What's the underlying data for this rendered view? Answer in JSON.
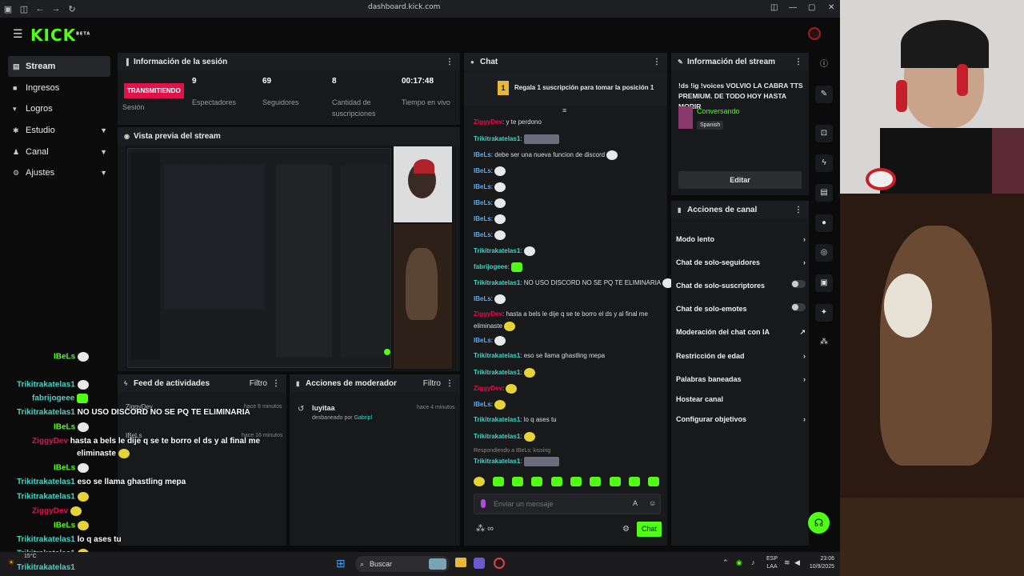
{
  "browser": {
    "url": "dashboard.kick.com"
  },
  "logo": "KICK",
  "logo_badge": "BETA",
  "sidebar": {
    "items": [
      {
        "label": "Stream"
      },
      {
        "label": "Ingresos"
      },
      {
        "label": "Logros"
      },
      {
        "label": "Estudio"
      },
      {
        "label": "Canal"
      },
      {
        "label": "Ajustes"
      }
    ]
  },
  "session": {
    "title": "Información de la sesión",
    "live_badge": "TRANSMITIENDO",
    "live_label": "Sesión",
    "stats": [
      {
        "value": "9",
        "label": "Espectadores"
      },
      {
        "value": "69",
        "label": "Seguidores"
      },
      {
        "value": "8",
        "label": "Cantidad de suscripciones"
      },
      {
        "value": "00:17:48",
        "label": "Tiempo en vivo"
      }
    ]
  },
  "preview": {
    "title": "Vista previa del stream"
  },
  "feed": {
    "title": "Feed de actividades",
    "filter": "Filtro",
    "items": [
      {
        "user": "ZiggyDev",
        "time": "hace 6 minutos"
      },
      {
        "user": "IBeLs",
        "time": "hace 16 minutos"
      }
    ]
  },
  "mod": {
    "title": "Acciones de moderador",
    "filter": "Filtro",
    "user": "luyitaa",
    "time": "hace 4 minutos",
    "action": "desbaneado por",
    "by": "Gabripl"
  },
  "chat": {
    "title": "Chat",
    "gift_text": "Regala 1 suscripción para tomar la posición 1",
    "gift_rank": "1",
    "messages": [
      {
        "user": "ZiggyDev",
        "text": ": y te perdono"
      },
      {
        "user": "Trikitrakatelas1",
        "text": ":"
      },
      {
        "user": "IBeLs",
        "text": ": debe ser una nueva funcion de discord"
      },
      {
        "user": "IBeLs",
        "text": ":"
      },
      {
        "user": "IBeLs",
        "text": ":"
      },
      {
        "user": "IBeLs",
        "text": ":"
      },
      {
        "user": "IBeLs",
        "text": ":"
      },
      {
        "user": "IBeLs",
        "text": ":"
      },
      {
        "user": "Trikitrakatelas1",
        "text": ":"
      },
      {
        "user": "fabrijogeee",
        "text": ":"
      },
      {
        "user": "Trikitrakatelas1",
        "text": ": NO USO DISCORD NO SE PQ TE ELIMINARIA"
      },
      {
        "user": "IBeLs",
        "text": ":"
      },
      {
        "user": "ZiggyDev",
        "text": ": hasta a bels le dije q se te borro el ds y al final me"
      },
      {
        "user": "",
        "text": "eliminaste"
      },
      {
        "user": "IBeLs",
        "text": ":"
      },
      {
        "user": "Trikitrakatelas1",
        "text": ": eso se llama ghastling mepa"
      },
      {
        "user": "Trikitrakatelas1",
        "text": ":"
      },
      {
        "user": "ZiggyDev",
        "text": ":"
      },
      {
        "user": "IBeLs",
        "text": ":"
      },
      {
        "user": "Trikitrakatelas1",
        "text": ": lo q ases tu"
      },
      {
        "user": "Trikitrakatelas1",
        "text": ":"
      },
      {
        "user": "",
        "text": "Respondiendo a IBeLs: kissing"
      },
      {
        "user": "Trikitrakatelas1",
        "text": ":"
      }
    ],
    "input_placeholder": "Enviar un mensaje",
    "send_label": "Chat",
    "infinity": "∞"
  },
  "stream_info": {
    "title": "Información del stream",
    "stream_title": "!ds !ig !voices VOLVIO LA CABRA TTS PREMIUM. DE TODO HOY HASTA MORIR",
    "category": "Conversando",
    "language": "Spanish",
    "edit_label": "Editar"
  },
  "channel_actions": {
    "title": "Acciones de canal",
    "items": [
      {
        "label": "Modo lento",
        "kind": "chevron"
      },
      {
        "label": "Chat de solo-seguidores",
        "kind": "chevron"
      },
      {
        "label": "Chat de solo-suscriptores",
        "kind": "toggle"
      },
      {
        "label": "Chat de solo-emotes",
        "kind": "toggle"
      },
      {
        "label": "Moderación del chat con IA",
        "kind": "external"
      },
      {
        "label": "Restricción de edad",
        "kind": "chevron"
      },
      {
        "label": "Palabras baneadas",
        "kind": "chevron"
      },
      {
        "label": "Hostear canal",
        "kind": "none"
      },
      {
        "label": "Configurar objetivos",
        "kind": "chevron"
      }
    ]
  },
  "overlay_chat": [
    {
      "user": "IBeLs",
      "text": ""
    },
    {
      "user": "Trikitrakatelas1",
      "text": ""
    },
    {
      "user": "fabrijogeee",
      "text": ""
    },
    {
      "user": "Trikitrakatelas1",
      "text": "NO USO DISCORD NO SE PQ TE ELIMINARIA"
    },
    {
      "user": "IBeLs",
      "text": ""
    },
    {
      "user": "ZiggyDev",
      "text": "hasta a bels le dije q se te borro el ds y al final me"
    },
    {
      "user": "",
      "text": "eliminaste"
    },
    {
      "user": "IBeLs",
      "text": ""
    },
    {
      "user": "Trikitrakatelas1",
      "text": "eso se llama ghastling mepa"
    },
    {
      "user": "Trikitrakatelas1",
      "text": ""
    },
    {
      "user": "ZiggyDev",
      "text": ""
    },
    {
      "user": "IBeLs",
      "text": ""
    },
    {
      "user": "Trikitrakatelas1",
      "text": "lo q ases tu"
    },
    {
      "user": "Trikitrakatelas1",
      "text": ""
    },
    {
      "user": "Trikitrakatelas1",
      "text": ""
    }
  ],
  "taskbar": {
    "search": "Buscar",
    "temp": "15°C",
    "lang_top": "ESP",
    "lang_bottom": "LAA",
    "time": "23:06",
    "date": "10/9/2025"
  },
  "colors": {
    "accent": "#53fc18",
    "live": "#e0124a",
    "panel": "#18191b"
  }
}
